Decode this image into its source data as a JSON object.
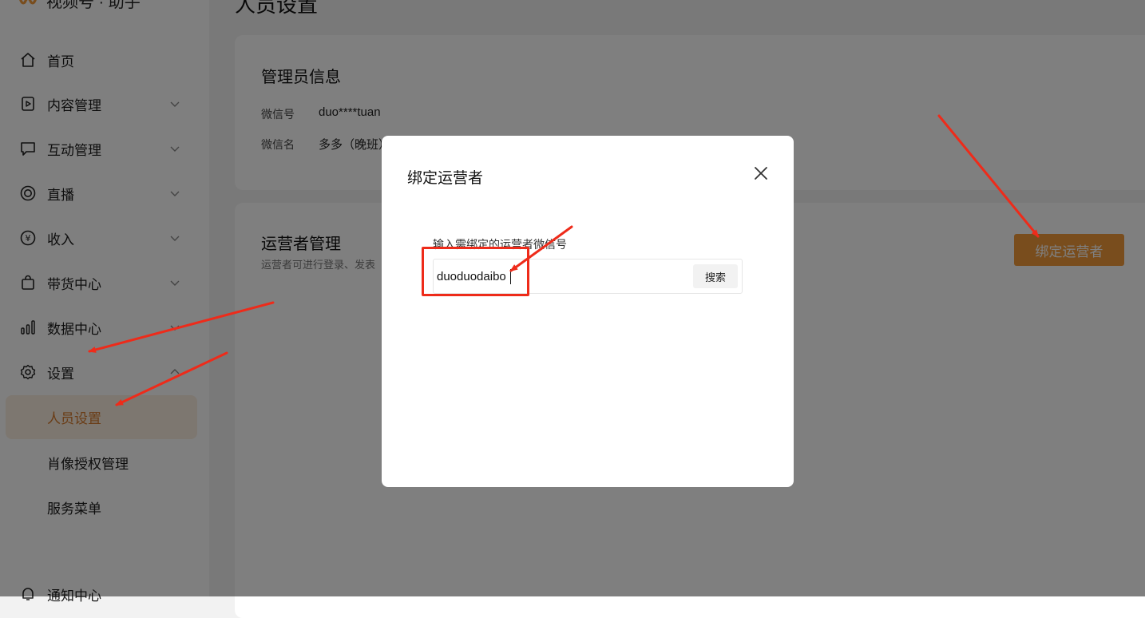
{
  "app": {
    "brand": "视频号 · 助手"
  },
  "sidebar": {
    "items": [
      {
        "label": "首页",
        "icon": "home-icon"
      },
      {
        "label": "内容管理",
        "icon": "video-content-icon"
      },
      {
        "label": "互动管理",
        "icon": "chat-icon"
      },
      {
        "label": "直播",
        "icon": "live-icon"
      },
      {
        "label": "收入",
        "icon": "yen-icon"
      },
      {
        "label": "带货中心",
        "icon": "shopping-bag-icon"
      },
      {
        "label": "数据中心",
        "icon": "bar-chart-icon"
      },
      {
        "label": "设置",
        "icon": "gear-icon"
      }
    ],
    "sub_items": [
      {
        "label": "人员设置",
        "active": true
      },
      {
        "label": "肖像授权管理"
      },
      {
        "label": "服务菜单"
      }
    ],
    "bottom_item": {
      "label": "通知中心",
      "icon": "bell-icon"
    }
  },
  "main": {
    "page_title": "人员设置",
    "admin_card": {
      "title": "管理员信息",
      "wechat_id_label": "微信号",
      "wechat_id_value": "duo****tuan",
      "wechat_name_label": "微信名",
      "wechat_name_value": "多多（晚班）"
    },
    "operator_card": {
      "title": "运营者管理",
      "description": "运营者可进行登录、发表",
      "bind_button": "绑定运营者"
    }
  },
  "modal": {
    "title": "绑定运营者",
    "field_label": "输入需绑定的运营者微信号",
    "input_value": "duoduodaibo",
    "search_button": "搜索"
  },
  "colors": {
    "accent": "#f39b3b",
    "active_text": "#d4782a",
    "annotation": "#ee2b1a"
  }
}
